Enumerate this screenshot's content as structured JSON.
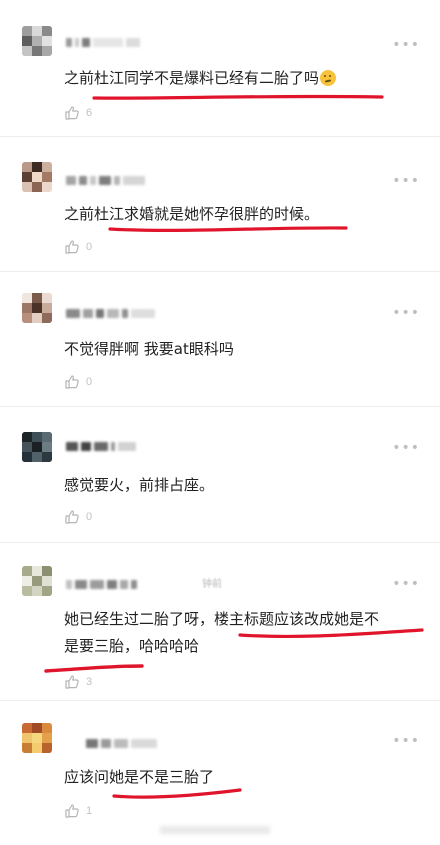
{
  "ui": {
    "more_glyph": "•••",
    "like_icon": "thumbs-up-icon",
    "underline_color": "#e0152c",
    "text_color": "#222222",
    "muted_color": "#b5b5b5"
  },
  "comments": [
    {
      "text_parts": [
        "之前杜江同学不是爆料已经有二胎了吗"
      ],
      "has_emoji": true,
      "emoji": "thinking-face-icon",
      "time": "",
      "likes": "6"
    },
    {
      "text_parts": [
        "之前杜江求婚就是她怀孕很胖的时候。"
      ],
      "has_emoji": false,
      "time": "",
      "likes": "0"
    },
    {
      "text_parts": [
        "不觉得胖啊  我要at眼科吗"
      ],
      "has_emoji": false,
      "time": "",
      "likes": "0"
    },
    {
      "text_parts": [
        "感觉要火，前排占座。"
      ],
      "has_emoji": false,
      "time": "",
      "likes": "0"
    },
    {
      "text_parts": [
        "她已经生过二胎了呀，楼主标题应该改成她是不",
        "是要三胎，哈哈哈哈"
      ],
      "has_emoji": false,
      "time": "钟前",
      "likes": "3"
    },
    {
      "text_parts": [
        "应该问她是不是三胎了"
      ],
      "has_emoji": false,
      "time": "",
      "likes": "1"
    }
  ]
}
